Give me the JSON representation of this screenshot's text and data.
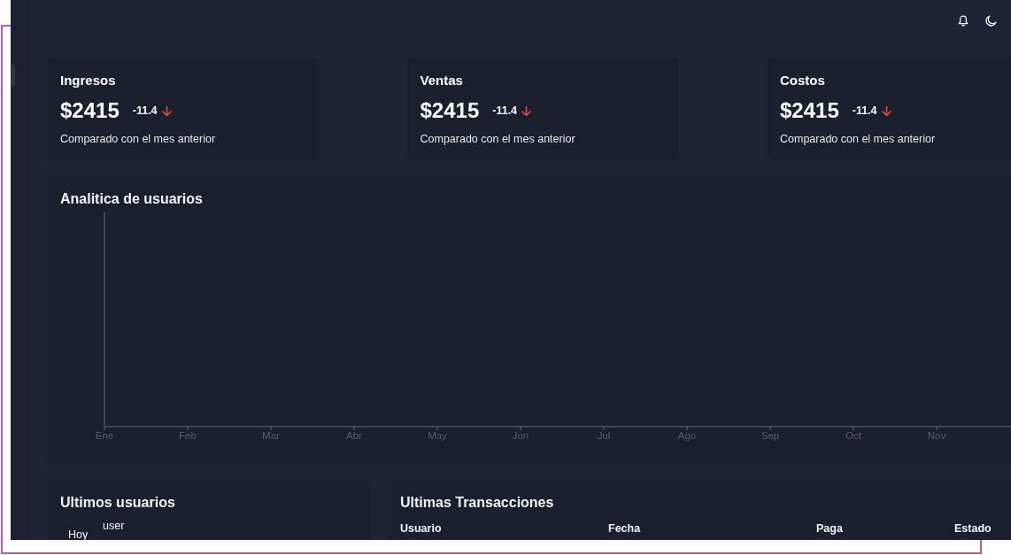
{
  "stat_cards": [
    {
      "title": "Ingresos",
      "amount": "$2415",
      "change": "-11.4",
      "trend_down": true,
      "caption": "Comparado con el mes anterior"
    },
    {
      "title": "Ventas",
      "amount": "$2415",
      "change": "-11.4",
      "trend_down": true,
      "caption": "Comparado con el mes anterior"
    },
    {
      "title": "Costos",
      "amount": "$2415",
      "change": "-11.4",
      "trend_down": true,
      "caption": "Comparado con el mes anterior"
    }
  ],
  "user_analytics": {
    "title": "Analitica de usuarios",
    "axis_labels": [
      "Ene",
      "Feb",
      "Mar",
      "Abr",
      "May",
      "Jun",
      "Jul",
      "Ago",
      "Sep",
      "Oct",
      "Nov"
    ]
  },
  "latest_users": {
    "title": "Ultimos usuarios",
    "rows": [
      {
        "date": "Hoy",
        "name": "user"
      }
    ]
  },
  "latest_transactions": {
    "title": "Ultimas Transacciones",
    "columns": [
      "Usuario",
      "Fecha",
      "Paga",
      "Estado"
    ]
  }
}
